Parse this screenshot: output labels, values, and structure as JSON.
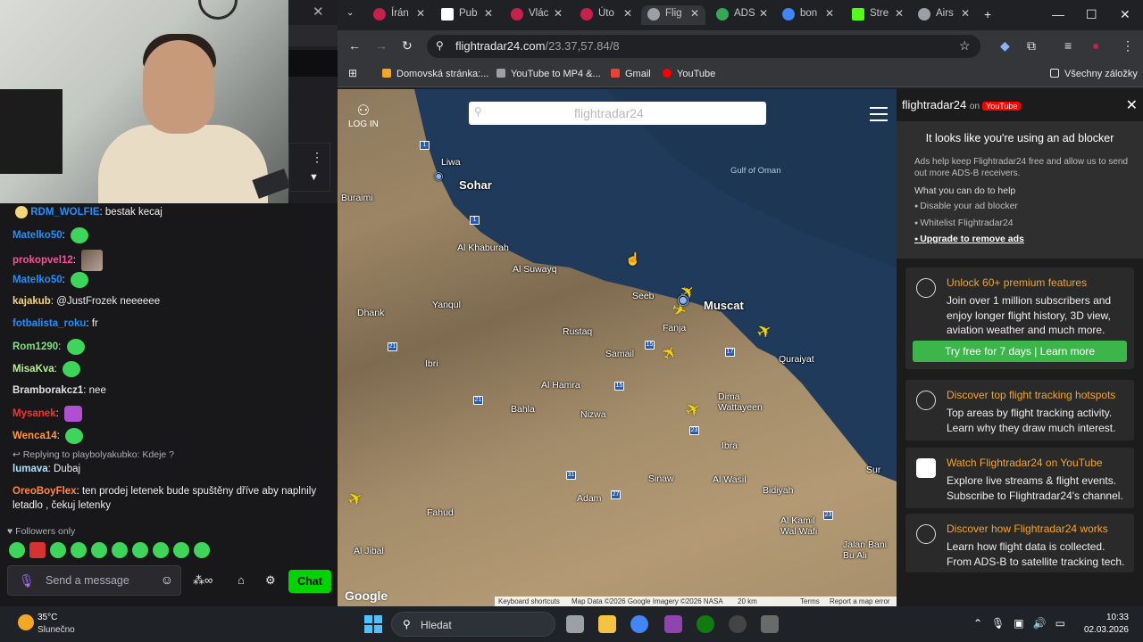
{
  "twitch": {
    "messages": [
      {
        "user": "RDM_WOLFIE",
        "color": "#1e90ff",
        "text": "bestak kecaj"
      },
      {
        "user": "Matelko50",
        "color": "#1e90ff",
        "text": ""
      },
      {
        "user": "prokopvel12",
        "color": "#ff4f9a",
        "text": ""
      },
      {
        "user": "Matelko50",
        "color": "#1e90ff",
        "text": ""
      },
      {
        "user": "kajakub",
        "color": "#f5d67a",
        "text": "@JustFrozek neeeeee"
      },
      {
        "user": "fotbalista_roku",
        "color": "#1e90ff",
        "text": "fr"
      },
      {
        "user": "Rom1290",
        "color": "#7ee07e",
        "text": ""
      },
      {
        "user": "MisaKva",
        "color": "#b6f08a",
        "text": ""
      },
      {
        "user": "Bramborakcz1",
        "color": "#e0e0e0",
        "text": "nee"
      },
      {
        "user": "Mysanek",
        "color": "#ff3030",
        "text": ""
      },
      {
        "user": "Wenca14",
        "color": "#ff9a3c",
        "text": ""
      },
      {
        "user": "lumava",
        "color": "#a8e6ff",
        "text": "Dubaj"
      },
      {
        "user": "OreoBoyFlex",
        "color": "#ff8a3c",
        "text": "ten prodej letenek bude spuštěny dříve aby naplnily letadlo , čekuj letenky"
      }
    ],
    "reply_to": "Replying to playbolyakubko: Kdeje ?",
    "followers_only": "Followers only",
    "input_placeholder": "Send a message",
    "chat_button": "Chat"
  },
  "browser": {
    "tabs": [
      {
        "label": "Írán",
        "icon": "linkedin-icon",
        "color": "#c7204a"
      },
      {
        "label": "Pub",
        "icon": "doc-icon",
        "color": "#ffffff"
      },
      {
        "label": "Vlác",
        "icon": "linkedin-icon",
        "color": "#c7204a"
      },
      {
        "label": "Úto",
        "icon": "linkedin-icon",
        "color": "#c7204a"
      },
      {
        "label": "Flig",
        "icon": "fr24-icon",
        "color": "#9aa0a6",
        "active": true
      },
      {
        "label": "ADS",
        "icon": "adsb-icon",
        "color": "#34a853"
      },
      {
        "label": "bon",
        "icon": "google-icon",
        "color": "#4285f4"
      },
      {
        "label": "Stre",
        "icon": "k-icon",
        "color": "#53fc18"
      },
      {
        "label": "Airs",
        "icon": "airspace-icon",
        "color": "#9aa0a6"
      }
    ],
    "url_host": "flightradar24.com",
    "url_path": "/23.37,57.84/8",
    "bookmarks": [
      "Domovská stránka:...",
      "YouTube to MP4 &...",
      "Gmail",
      "YouTube"
    ],
    "all_bookmarks": "Všechny záložky"
  },
  "map": {
    "login": "LOG IN",
    "logo": "flightradar24",
    "cities": [
      "Liwa",
      "Sohar",
      "Buraimi",
      "Al Khaburah",
      "Al Suwayq",
      "Seeb",
      "Muscat",
      "Yanqul",
      "Dhank",
      "Rustaq",
      "Fanja",
      "Samail",
      "Ibri",
      "Al Hamra",
      "Nizwa",
      "Bahla",
      "Dima Wattayeen",
      "Ibra",
      "Quraiyat",
      "Sinaw",
      "Adam",
      "Al Wasil",
      "Bidiyah",
      "Fahud",
      "Al Jibal",
      "Al Kamil Wal Wafi",
      "Jalan Bani Bu Ali",
      "Sur"
    ],
    "sea_label": "Gulf of Oman",
    "google": "Google",
    "attribution": [
      "Keyboard shortcuts",
      "Map Data ©2026 Google Imagery ©2026 NASA",
      "20 km",
      "Terms",
      "Report a map error"
    ]
  },
  "sidebar": {
    "brand": "flightradar24",
    "on": "on",
    "yt": "YouTube",
    "adblock_title": "It looks like you're using an ad blocker",
    "adblock_text": "Ads help keep Flightradar24 free and allow us to send out more ADS-B receivers.",
    "what": "What you can do to help",
    "options": [
      "Disable your ad blocker",
      "Whitelist Flightradar24",
      "Upgrade to remove ads"
    ],
    "cards": [
      {
        "title": "Unlock 60+ premium features",
        "desc": "Join over 1 million subscribers and enjoy longer flight history, 3D view, aviation weather and much more.",
        "icon": "premium-icon"
      },
      {
        "title": "Discover top flight tracking hotspots",
        "desc": "Top areas by flight tracking activity. Learn why they draw much interest.",
        "icon": "hotspot-icon"
      },
      {
        "title": "Watch Flightradar24 on YouTube",
        "desc": "Explore live streams & flight events. Subscribe to Flightradar24's channel.",
        "icon": "youtube-icon"
      },
      {
        "title": "Discover how Flightradar24 works",
        "desc": "Learn how flight data is collected. From ADS-B to satellite tracking tech.",
        "icon": "antenna-icon"
      }
    ],
    "trial_button": "Try free for 7 days | Learn more"
  },
  "taskbar": {
    "temp": "35°C",
    "cond": "Slunečno",
    "search": "Hledat",
    "time": "10:33",
    "date": "02.03.2026"
  }
}
